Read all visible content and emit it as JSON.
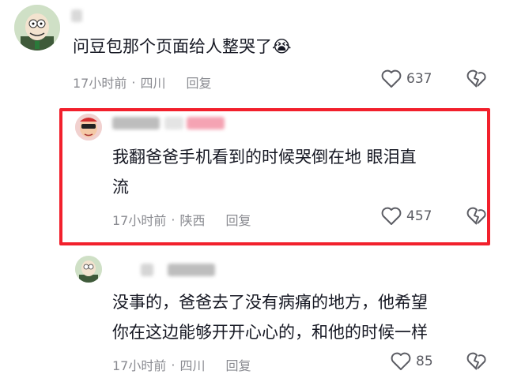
{
  "comments": [
    {
      "text": "问豆包那个页面给人整哭了😭",
      "time": "17小时前",
      "location": "四川",
      "reply_label": "回复",
      "likes": "637"
    },
    {
      "text_line1": "我翻爸爸手机看到的时候哭倒在地 眼泪直",
      "text_line2": "流",
      "time": "17小时前",
      "location": "陕西",
      "reply_label": "回复",
      "likes": "457"
    },
    {
      "text_line1": "没事的，爸爸去了没有病痛的地方，他希望",
      "text_line2": "你在这边能够开开心心的，和他的时候一样",
      "time": "17小时前",
      "location": "四川",
      "reply_label": "回复",
      "likes": "85"
    }
  ],
  "separator": "·",
  "colors": {
    "highlight_border": "#f2202c",
    "meta": "#8a8b91",
    "text": "#161823"
  }
}
